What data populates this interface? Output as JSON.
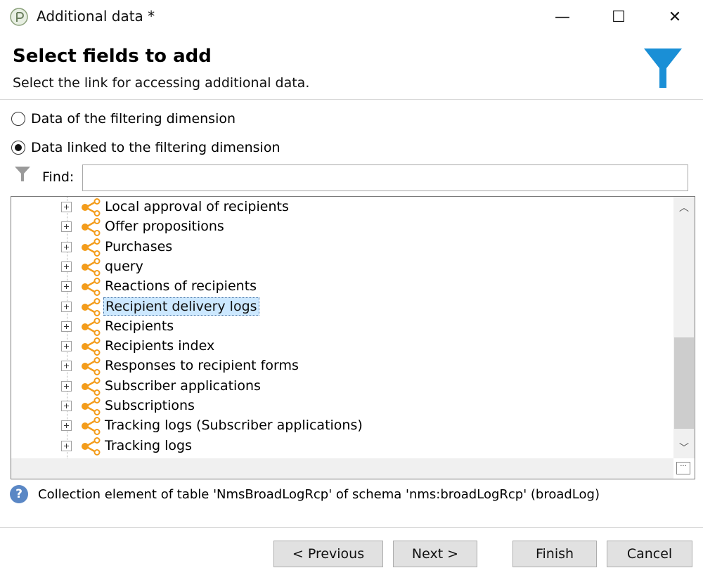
{
  "window": {
    "title": "Additional data *",
    "minimize_glyph": "—",
    "maximize_glyph": "☐",
    "close_glyph": "✕"
  },
  "header": {
    "title": "Select fields to add",
    "subtitle": "Select the link for accessing additional data.",
    "icon": "funnel-icon",
    "accent_color": "#1a8fd6"
  },
  "options": {
    "filtering_dimension": {
      "label": "Data of the filtering dimension",
      "checked": false
    },
    "linked_dimension": {
      "label": "Data linked to the filtering dimension",
      "checked": true
    }
  },
  "find": {
    "label": "Find:",
    "value": ""
  },
  "tree": {
    "link_icon_color": "#f39c1b",
    "selected_index": 5,
    "items": [
      {
        "label": "Local approval of recipients"
      },
      {
        "label": "Offer propositions"
      },
      {
        "label": "Purchases"
      },
      {
        "label": "query"
      },
      {
        "label": "Reactions of recipients"
      },
      {
        "label": "Recipient delivery logs"
      },
      {
        "label": "Recipients"
      },
      {
        "label": "Recipients index"
      },
      {
        "label": "Responses to recipient forms"
      },
      {
        "label": "Subscriber applications"
      },
      {
        "label": "Subscriptions"
      },
      {
        "label": "Tracking logs (Subscriber applications)"
      },
      {
        "label": "Tracking logs"
      }
    ]
  },
  "status": {
    "text": "Collection element of table 'NmsBroadLogRcp' of schema 'nms:broadLogRcp' (broadLog)"
  },
  "buttons": {
    "previous": "< Previous",
    "next": "Next >",
    "finish": "Finish",
    "cancel": "Cancel"
  }
}
